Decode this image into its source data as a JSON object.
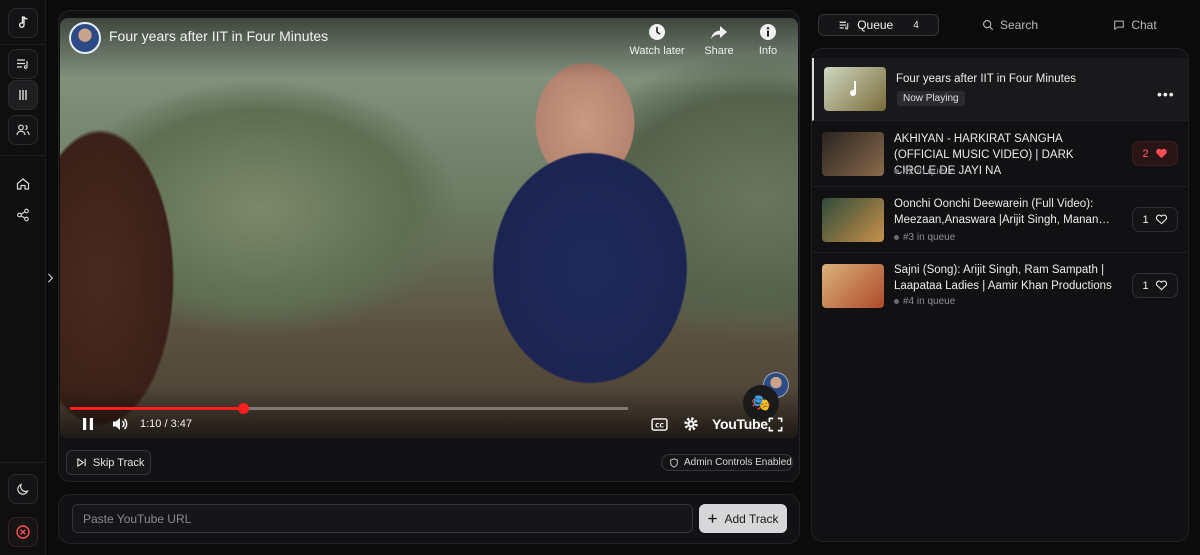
{
  "sidebar": {
    "icons": [
      "music-note-icon",
      "queue-list-icon",
      "bars-icon",
      "users-icon",
      "home-icon",
      "share-icon",
      "moon-icon",
      "close-circle-icon",
      "chevron-right-icon"
    ]
  },
  "player": {
    "title": "Four years after IIT in Four Minutes",
    "actions": [
      {
        "label": "Watch later",
        "icon": "clock-icon"
      },
      {
        "label": "Share",
        "icon": "share-arrow-icon"
      },
      {
        "label": "Info",
        "icon": "info-icon"
      }
    ],
    "time": "1:10 / 3:47",
    "progress": 0.31,
    "buffered": 0.96,
    "brand": "YouTube",
    "mini_emoji": "🎭"
  },
  "controls": {
    "skip_label": "Skip Track",
    "admin_label": "Admin Controls Enabled"
  },
  "add_track": {
    "placeholder": "Paste YouTube URL",
    "button_label": "Add Track"
  },
  "tabs": [
    {
      "label": "Queue",
      "count": "4",
      "active": true
    },
    {
      "label": "Search"
    },
    {
      "label": "Chat"
    }
  ],
  "queue": [
    {
      "title": "Four years after IIT in Four Minutes",
      "badge": "Now Playing",
      "more": "•••",
      "colors": [
        "#cfd8c2",
        "#7a6c3a"
      ]
    },
    {
      "title": "AKHIYAN - HARKIRAT SANGHA (OFFICIAL MUSIC VIDEO) | DARK CIRCLE DE JAYI NA",
      "sub": "#2 in queue",
      "votes": "2",
      "liked": true,
      "colors": [
        "#2a2422",
        "#8a6b4a"
      ]
    },
    {
      "title": "Oonchi Oonchi Deewarein (Full Video): Meezaan,Anaswara |Arijit Singh, Manan…",
      "sub": "#3 in queue",
      "votes": "1",
      "liked": false,
      "colors": [
        "#2e4a3a",
        "#c9914a"
      ]
    },
    {
      "title": "Sajni (Song): Arijit Singh, Ram Sampath | Laapataa Ladies | Aamir Khan Productions",
      "sub": "#4 in queue",
      "votes": "1",
      "liked": false,
      "colors": [
        "#d9b27a",
        "#b04a2a"
      ]
    }
  ]
}
